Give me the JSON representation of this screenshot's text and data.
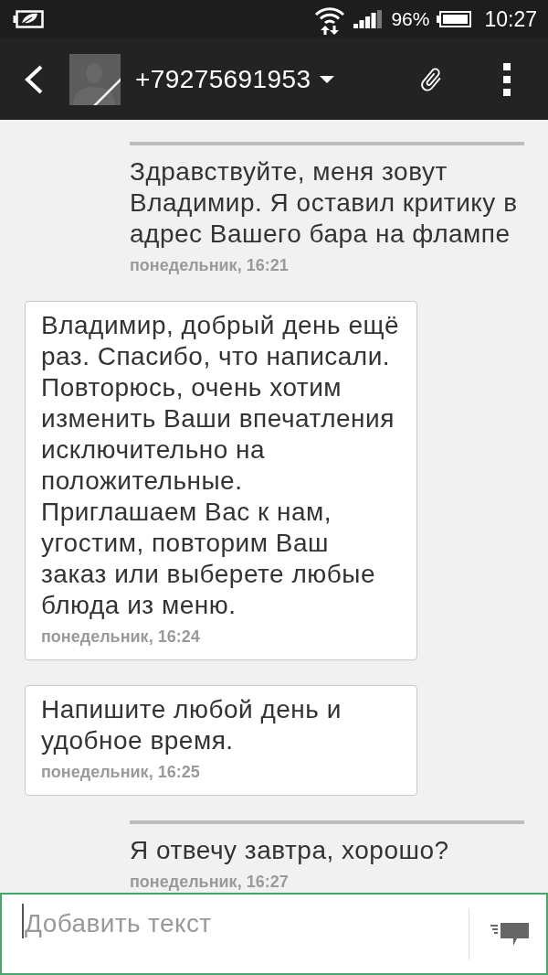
{
  "status_bar": {
    "battery": "96%",
    "time": "10:27"
  },
  "header": {
    "contact": "+79275691953"
  },
  "messages": [
    {
      "kind": "sent",
      "text": "Здравствуйте, меня зовут Владимир. Я оставил критику в адрес Вашего бара на флампе",
      "time": "понедельник, 16:21"
    },
    {
      "kind": "received",
      "text": "Владимир, добрый день ещё раз. Спасибо, что написали. Повторюсь, очень хотим изменить Ваши впечатления исключительно на положительные. Приглашаем Вас к нам, угостим, повторим Ваш заказ или выберете любые блюда из меню.",
      "time": "понедельник, 16:24"
    },
    {
      "kind": "received",
      "text": "Напишите любой день и удобное время.",
      "time": "понедельник, 16:25"
    },
    {
      "kind": "sent",
      "text": "Я отвечу завтра, хорошо?",
      "time": "понедельник, 16:27"
    }
  ],
  "composer": {
    "placeholder": "Добавить текст"
  }
}
